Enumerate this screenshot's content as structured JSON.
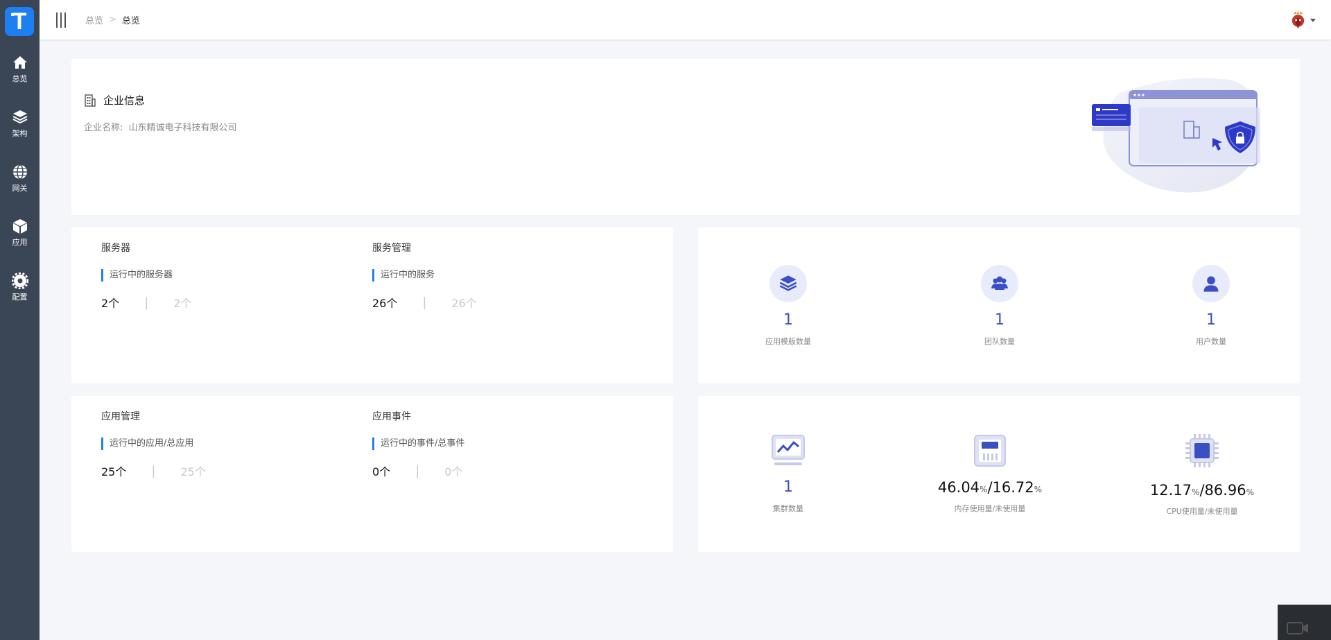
{
  "app": {
    "logo_letter": "T"
  },
  "sidebar": {
    "items": [
      {
        "label": "总览",
        "icon": "home-icon"
      },
      {
        "label": "架构",
        "icon": "layers-icon"
      },
      {
        "label": "网关",
        "icon": "globe-icon"
      },
      {
        "label": "应用",
        "icon": "cube-icon"
      },
      {
        "label": "配置",
        "icon": "gear-icon"
      }
    ]
  },
  "header": {
    "breadcrumb": {
      "parent": "总览",
      "separator": ">",
      "current": "总览"
    }
  },
  "company": {
    "title": "企业信息",
    "name_label": "企业名称:",
    "name_value": "山东精诚电子科技有限公司"
  },
  "servers": {
    "title": "服务器",
    "subtitle": "运行中的服务器",
    "running": "2个",
    "total": "2个"
  },
  "services": {
    "title": "服务管理",
    "subtitle": "运行中的服务",
    "running": "26个",
    "total": "26个"
  },
  "apps": {
    "title": "应用管理",
    "subtitle": "运行中的应用/总应用",
    "running": "25个",
    "total": "25个"
  },
  "events": {
    "title": "应用事件",
    "subtitle": "运行中的事件/总事件",
    "running": "0个",
    "total": "0个"
  },
  "counts": [
    {
      "value": "1",
      "label": "应用模版数量",
      "icon": "layers-icon"
    },
    {
      "value": "1",
      "label": "团队数量",
      "icon": "team-icon"
    },
    {
      "value": "1",
      "label": "用户数量",
      "icon": "user-icon"
    }
  ],
  "resources": {
    "clusters": {
      "value": "1",
      "label": "集群数量",
      "icon": "monitor-chart-icon"
    },
    "memory": {
      "used": "46.04",
      "unused": "16.72",
      "unit": "%",
      "slash": "/",
      "label": "内存使用量/未使用量",
      "icon": "memory-icon"
    },
    "cpu": {
      "used": "12.17",
      "unused": "86.96",
      "unit": "%",
      "slash": "/",
      "label": "CPU使用量/未使用量",
      "icon": "cpu-chip-icon"
    }
  },
  "colors": {
    "sidebar_bg": "#3a4556",
    "accent": "#1d7ff2",
    "stat_blue": "#3b4fc4",
    "page_bg": "#f5f6f9"
  }
}
